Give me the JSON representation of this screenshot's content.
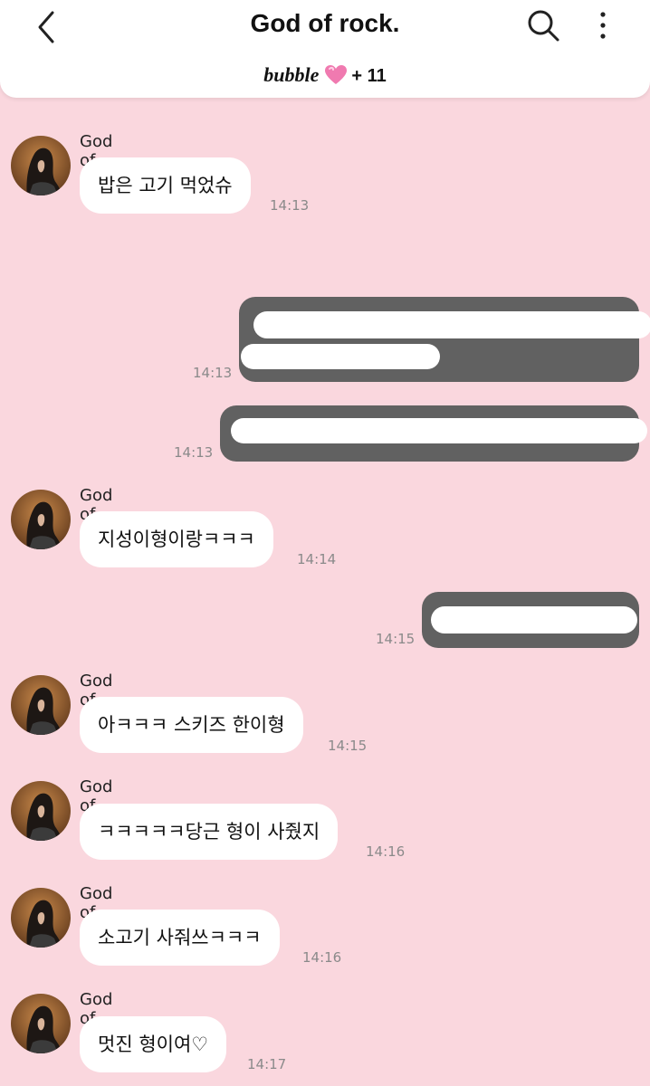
{
  "header": {
    "title": "God of rock.",
    "brand": "bubble",
    "count": "+ 11"
  },
  "messages": [
    {
      "sender": "God of rock.",
      "text": "밥은 고기 먹었슈",
      "time": "14:13"
    },
    {
      "sender": "God of rock.",
      "text": "지성이형이랑ㅋㅋㅋ",
      "time": "14:14"
    },
    {
      "sender": "God of rock.",
      "text": "아ㅋㅋㅋ 스키즈 한이형",
      "time": "14:15"
    },
    {
      "sender": "God of rock.",
      "text": "ㅋㅋㅋㅋㅋ당근 형이 사줬지",
      "time": "14:16"
    },
    {
      "sender": "God of rock.",
      "text": "소고기 사줘쓰ㅋㅋㅋ",
      "time": "14:16"
    },
    {
      "sender": "God of rock.",
      "text": "멋진 형이여♡",
      "time": "14:17"
    }
  ],
  "outgoing": [
    {
      "time": "14:13"
    },
    {
      "time": "14:13"
    },
    {
      "time": "14:15"
    }
  ],
  "colors": {
    "background": "#fad7de",
    "outgoing_bubble": "#616161",
    "heart": "#f07ab0"
  }
}
